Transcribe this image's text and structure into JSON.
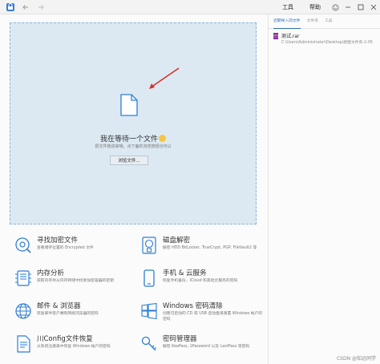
{
  "titlebar": {
    "menu": [
      "工具",
      "帮助"
    ],
    "icons": [
      "app-logo-icon",
      "back-arrow-icon",
      "forward-arrow-icon",
      "smiley-icon",
      "minimize-icon",
      "maximize-icon",
      "close-icon"
    ]
  },
  "dropzone": {
    "title": "我在等待一个文件",
    "subtitle": "把文件拖进来哦，点下面的浏览按钮也可以",
    "browse_label": "浏览文件..."
  },
  "features": [
    {
      "title": "寻找加密文件",
      "desc": "查看储存位置的 Encrypted 文件",
      "icon": "disc-search-icon"
    },
    {
      "title": "磁盘解密",
      "desc": "解密 HDD BitLocker, TrueCrypt, PGP, FileVault2 等",
      "icon": "disk-lock-icon"
    },
    {
      "title": "内存分析",
      "desc": "获取内存并从内存转储中找到加密容器的密钥",
      "icon": "memory-icon"
    },
    {
      "title": "手机 & 云服务",
      "desc": "恢复手机备份，iCloud 和其他云服务的密码",
      "icon": "phone-icon"
    },
    {
      "title": "邮件 & 浏览器",
      "desc": "恢复邮件客户端和网络浏览器的密码",
      "icon": "globe-mail-icon"
    },
    {
      "title": "Windows 密码清除",
      "desc": "创建可启动的 CD 或 USB 启动盘来重置 Windows 帐户的密码",
      "icon": "windows-icon"
    },
    {
      "title": "川Config文件恢复",
      "desc": "从系统注册表中恢复 Windows 帐户的密码",
      "icon": "config-file-icon"
    },
    {
      "title": "密码管理器",
      "desc": "解密 KeePass, 1Password 以及 LastPass 等密码",
      "icon": "keys-icon"
    }
  ],
  "side": {
    "tabs": [
      "近期导入的文件",
      "文件夹",
      "工具"
    ],
    "active_tab": 0,
    "recent": [
      {
        "name": "测试.rar",
        "path": "C:\\Users\\Administrator\\Desktop\\新建文件夹-2-05"
      }
    ]
  },
  "watermark": "CSDN @知远同学",
  "colors": {
    "dropzone_bg": "#dce9f3",
    "accent": "#2d6fb7",
    "arrow": "#d9302b"
  }
}
